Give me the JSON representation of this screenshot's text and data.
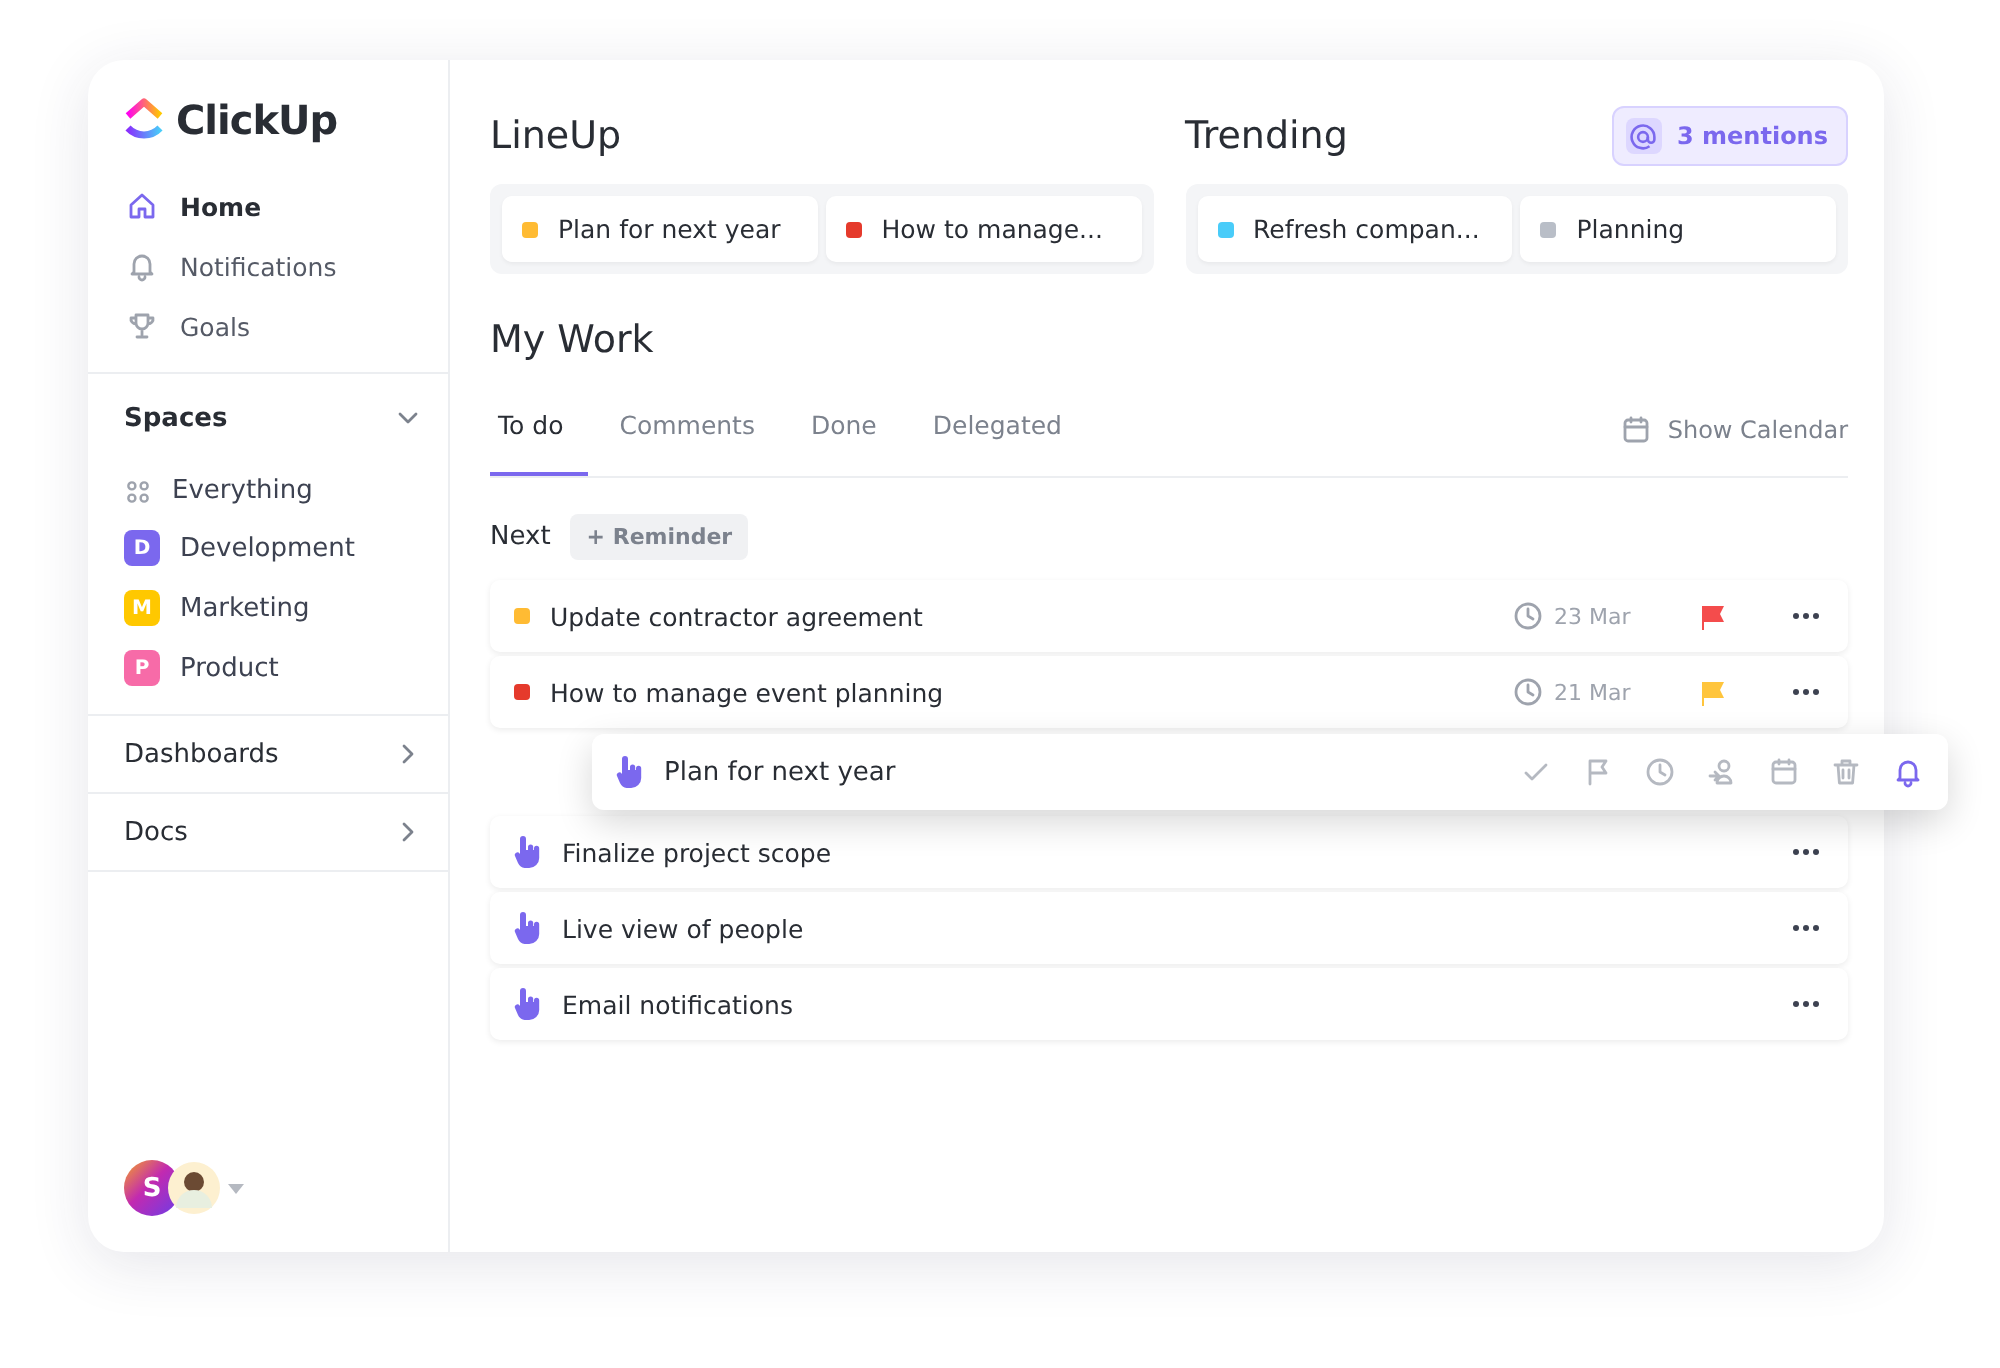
{
  "brand": {
    "name": "ClickUp"
  },
  "nav": [
    {
      "label": "Home",
      "kind": "home",
      "selected": true
    },
    {
      "label": "Notifications",
      "kind": "bell",
      "selected": false
    },
    {
      "label": "Goals",
      "kind": "trophy",
      "selected": false
    }
  ],
  "spaces": {
    "title": "Spaces",
    "expanded": true,
    "items": [
      {
        "kind": "all",
        "label": "Everything"
      },
      {
        "kind": "space",
        "label": "Development",
        "badge": "D",
        "color": "#7b68ee"
      },
      {
        "kind": "space",
        "label": "Marketing",
        "badge": "M",
        "color": "#ffc800"
      },
      {
        "kind": "space",
        "label": "Product",
        "badge": "P",
        "color": "#f76ba8"
      }
    ]
  },
  "sections": [
    {
      "label": "Dashboards"
    },
    {
      "label": "Docs"
    }
  ],
  "user": {
    "initial": "S"
  },
  "mentions": "3 mentions",
  "lineup": {
    "title": "LineUp",
    "items": [
      {
        "label": "Plan for next year",
        "color": "#ffbb33"
      },
      {
        "label": "How to manage...",
        "color": "#e53a2c"
      }
    ]
  },
  "trending": {
    "title": "Trending",
    "items": [
      {
        "label": "Refresh compan...",
        "color": "#49ccf9"
      },
      {
        "label": "Planning",
        "color": "#b9bec7"
      }
    ]
  },
  "my_work": {
    "title": "My Work",
    "tabs": [
      {
        "label": "To do",
        "selected": true
      },
      {
        "label": "Comments",
        "selected": false
      },
      {
        "label": "Done",
        "selected": false
      },
      {
        "label": "Delegated",
        "selected": false
      }
    ],
    "show_calendar": "Show Calendar",
    "next_label": "Next",
    "reminder": "+ Reminder",
    "tasks": [
      {
        "kind": "task",
        "label": "Update contractor agreement",
        "color": "#ffbb33",
        "date": "23 Mar",
        "flag": {
          "color": "#f44c4c"
        }
      },
      {
        "kind": "task",
        "label": "How to manage event planning",
        "color": "#e53a2c",
        "date": "21 Mar",
        "flag": {
          "color": "#ffc53d"
        }
      },
      {
        "kind": "dragged",
        "label": "Plan for next year",
        "actions": [
          {
            "kind": "check",
            "selected": false
          },
          {
            "kind": "flag",
            "selected": false
          },
          {
            "kind": "clock",
            "selected": false
          },
          {
            "kind": "assign",
            "selected": false
          },
          {
            "kind": "calendar",
            "selected": false
          },
          {
            "kind": "trash",
            "selected": false
          },
          {
            "kind": "bell",
            "selected": true
          }
        ]
      },
      {
        "kind": "reminder",
        "label": "Finalize project scope"
      },
      {
        "kind": "reminder",
        "label": "Live view of people"
      },
      {
        "kind": "reminder",
        "label": "Email notifications"
      }
    ]
  }
}
